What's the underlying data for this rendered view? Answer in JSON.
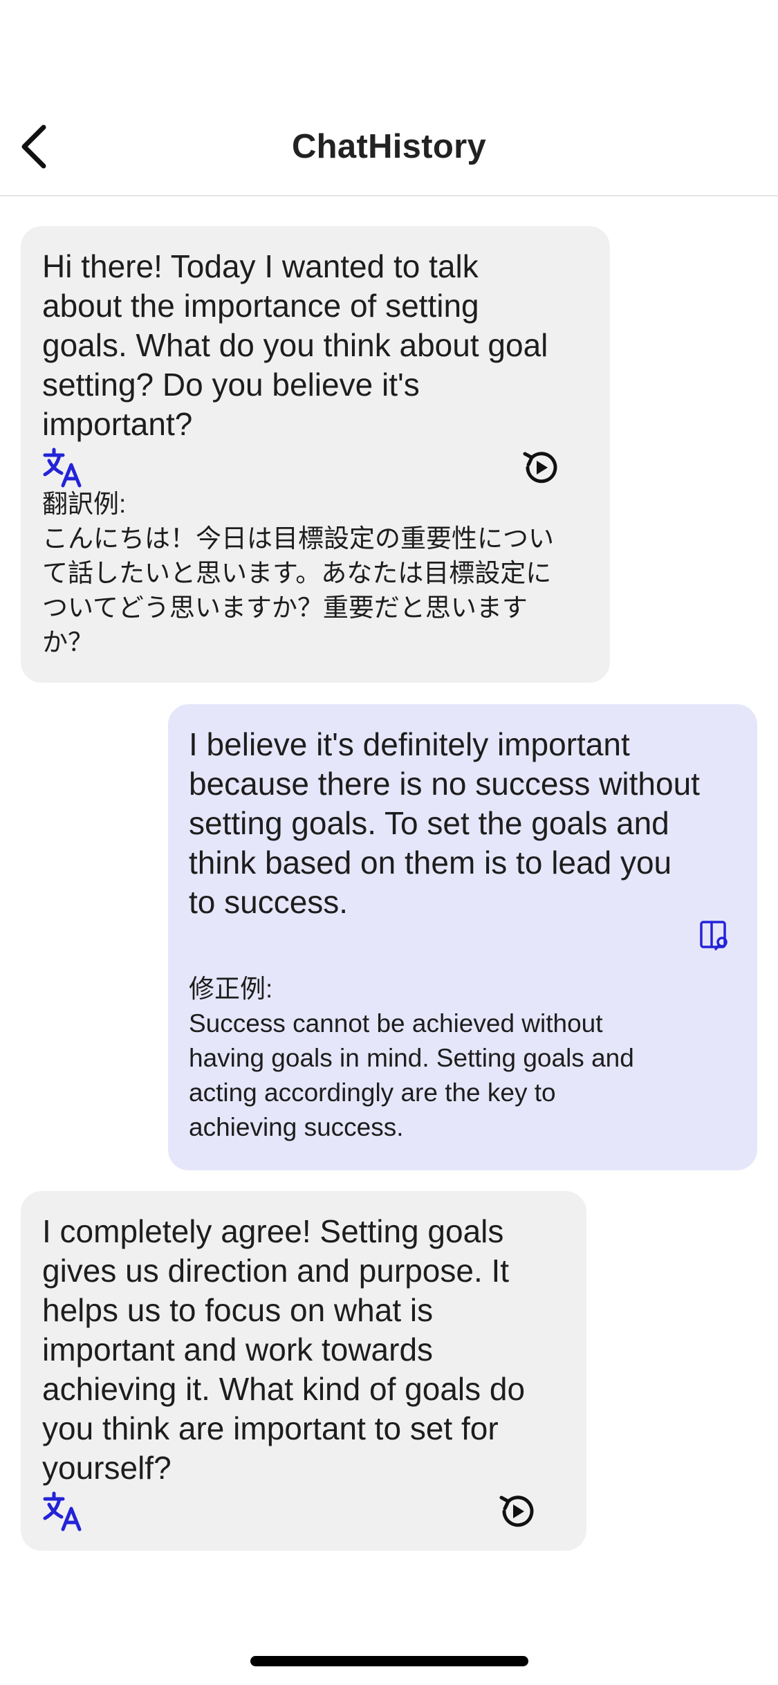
{
  "header": {
    "title": "ChatHistory",
    "back_icon": "chevron-left-icon"
  },
  "messages": [
    {
      "role": "assistant",
      "text": "Hi there! Today I wanted to talk\nabout the importance of setting\ngoals. What do you think about goal\nsetting? Do you believe it's\nimportant?",
      "translate_icon": "translate-icon",
      "replay_icon": "replay-icon",
      "translation_label": "翻訳例:",
      "translation_text": "こんにちは！今日は目標設定の重要性につい\nて話したいと思います。あなたは目標設定に\nついてどう思いますか？重要だと思います\nか？"
    },
    {
      "role": "user",
      "text": "I believe it's definitely important\nbecause there is no success without\nsetting goals. To set the goals and\nthink based on them is to lead you\nto success.",
      "correction_icon": "correction-icon",
      "correction_label": "修正例:",
      "correction_text": "Success cannot be achieved without\nhaving goals in mind. Setting goals and\nacting accordingly are the key to\nachieving success."
    },
    {
      "role": "assistant",
      "text": "I completely agree! Setting goals\ngives us direction and purpose. It\nhelps us to focus on what is\nimportant and work towards\nachieving it. What kind of goals do\nyou think are important to set for\nyourself?",
      "translate_icon": "translate-icon",
      "replay_icon": "replay-icon"
    }
  ],
  "colors": {
    "assistant_bubble": "#f0f0f0",
    "user_bubble": "#e6e6fa",
    "icon_blue": "#2323d8",
    "text": "#1d1d1d"
  }
}
